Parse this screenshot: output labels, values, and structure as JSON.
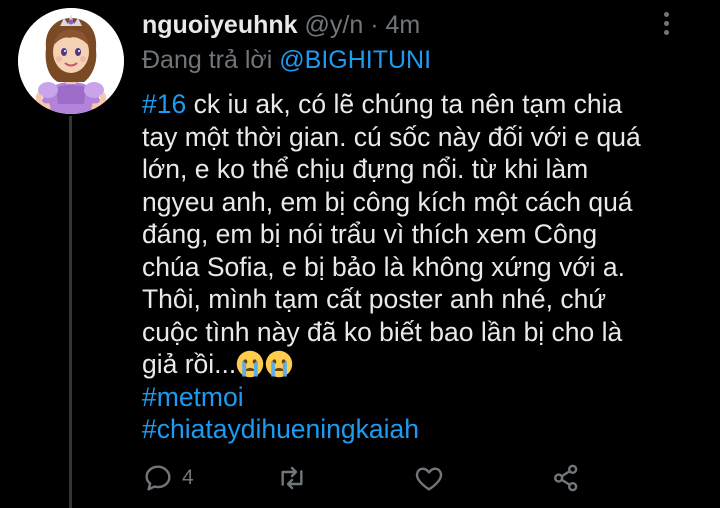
{
  "tweet": {
    "display_name": "nguoiyeuhnk",
    "handle": "@y/n",
    "separator": "·",
    "time": "4m",
    "reply_prefix": "Đang trả lời ",
    "reply_mention": "@BIGHITUNI",
    "body": {
      "hashtag_first": "#16",
      "line1_rest": " ck iu ak, có lẽ chúng ta nên tạm chia",
      "line2": "tay một thời gian. cú sốc này đối với e quá",
      "line3": "lớn, e ko thể chịu đựng nổi. từ khi làm",
      "line4": "ngyeu anh, em bị công kích một cách quá",
      "line5": "đáng, em bị nói trẩu vì thích xem Công",
      "line6": "chúa Sofia, e bị bảo là không xứng với a.",
      "line7": "Thôi, mình tạm cất poster anh nhé, chứ",
      "line8": "cuộc tình này đã ko biết bao lần bị cho là",
      "line9": "giả rồi...",
      "hashtag_2": "#metmoi",
      "hashtag_3": "#chiataydihueningkaiah"
    },
    "emojis": [
      "crying-face-icon",
      "crying-face-icon"
    ],
    "actions": {
      "reply_count": "4",
      "retweet_count": "",
      "like_count": ""
    },
    "colors": {
      "background": "#000000",
      "text": "#e7e9ea",
      "muted": "#71767b",
      "link": "#1d9bf0"
    }
  }
}
